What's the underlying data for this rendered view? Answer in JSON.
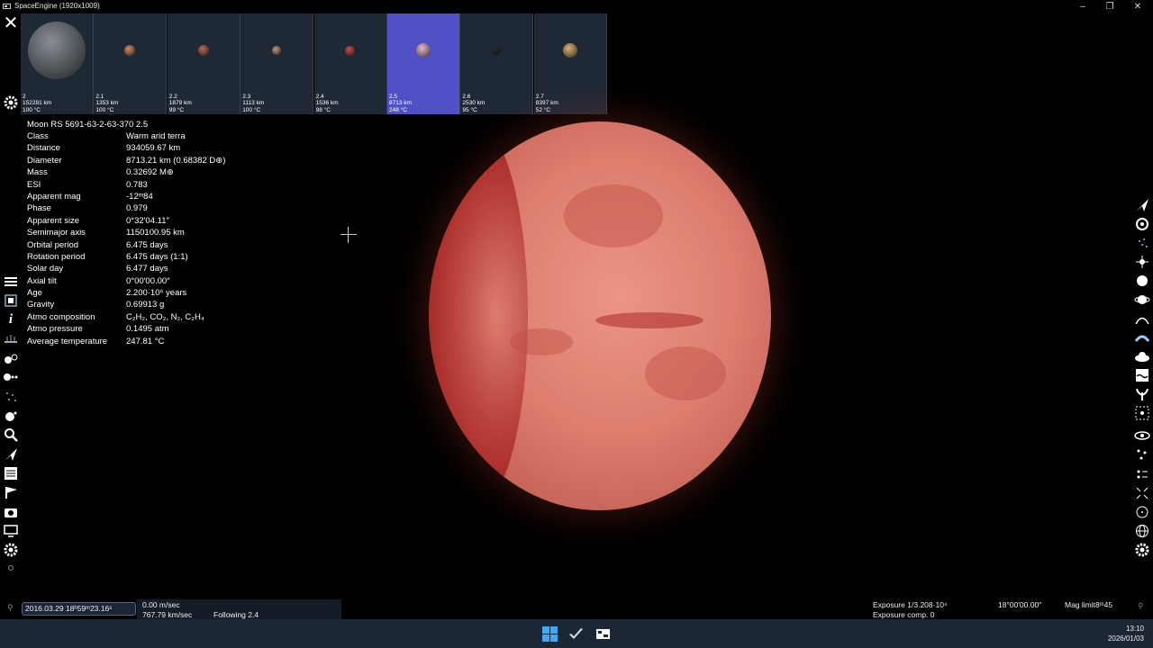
{
  "window": {
    "title": "SpaceEngine (1920x1009)",
    "controls": [
      "minimize-icon",
      "restore-icon",
      "close-icon"
    ]
  },
  "thumbnails": [
    {
      "id": "2",
      "size": "152281 km",
      "temp": "100 °C",
      "color": "#8a8f96",
      "selected": false
    },
    {
      "id": "2.1",
      "size": "1353 km",
      "temp": "100 °C",
      "color": "#d2876a",
      "selected": false
    },
    {
      "id": "2.2",
      "size": "1879 km",
      "temp": "99 °C",
      "color": "#b76b58",
      "selected": false
    },
    {
      "id": "2.3",
      "size": "1113 km",
      "temp": "100 °C",
      "color": "#c2957a",
      "selected": false
    },
    {
      "id": "2.4",
      "size": "1536 km",
      "temp": "98 °C",
      "color": "#c74e52",
      "selected": false
    },
    {
      "id": "2.5",
      "size": "8713 km",
      "temp": "248 °C",
      "color": "#e5b8c7",
      "selected": true
    },
    {
      "id": "2.6",
      "size": "2530 km",
      "temp": "95 °C",
      "color": "#2a2e33",
      "selected": false
    },
    {
      "id": "2.7",
      "size": "8397 km",
      "temp": "52 °C",
      "color": "#d8b072",
      "selected": false
    }
  ],
  "info": {
    "header": "Moon  RS 5691-63-2-63-370 2.5",
    "rows": [
      {
        "label": "Class",
        "value": "Warm arid terra"
      },
      {
        "label": "Distance",
        "value": "934059.67 km"
      },
      {
        "label": "Diameter",
        "value": "8713.21 km (0.68382 D⊕)"
      },
      {
        "label": "Mass",
        "value": "0.32692 M⊕"
      },
      {
        "label": "ESI",
        "value": "0.783"
      },
      {
        "label": "Apparent mag",
        "value": "-12ᵐ84"
      },
      {
        "label": "Phase",
        "value": "0.979"
      },
      {
        "label": "Apparent size",
        "value": "0°32′04.11″"
      },
      {
        "label": "Semimajor axis",
        "value": "1150100.95 km"
      },
      {
        "label": "Orbital period",
        "value": "6.475 days"
      },
      {
        "label": "Rotation period",
        "value": "6.475 days (1:1)"
      },
      {
        "label": "Solar day",
        "value": "6.477 days"
      },
      {
        "label": "Axial tilt",
        "value": "0°00′00.00″"
      },
      {
        "label": "Age",
        "value": "2.200·10⁶ years"
      },
      {
        "label": "Gravity",
        "value": "0.69913 g"
      },
      {
        "label": "Atmo composition",
        "value": "C₂H₂, CO₂, N₂, C₂H₄"
      },
      {
        "label": "Atmo pressure",
        "value": "0.1495 atm"
      },
      {
        "label": "Average temperature",
        "value": "247.81 °C"
      }
    ]
  },
  "status": {
    "datetime": "2016.03.29 18ʰ59ᵐ23.16ˢ",
    "speed1": "0.00 m/sec",
    "speed2": "767.79 km/sec",
    "following": "Following 2.4",
    "exposure": "Exposure 1/3.208·10⁴",
    "exposure_comp": "Exposure comp. 0",
    "fov": "18°00′00.00″",
    "mag_limit": "Mag limit8ᵐ45"
  },
  "taskbar": {
    "time": "13:10",
    "date": "2026/01/03"
  }
}
